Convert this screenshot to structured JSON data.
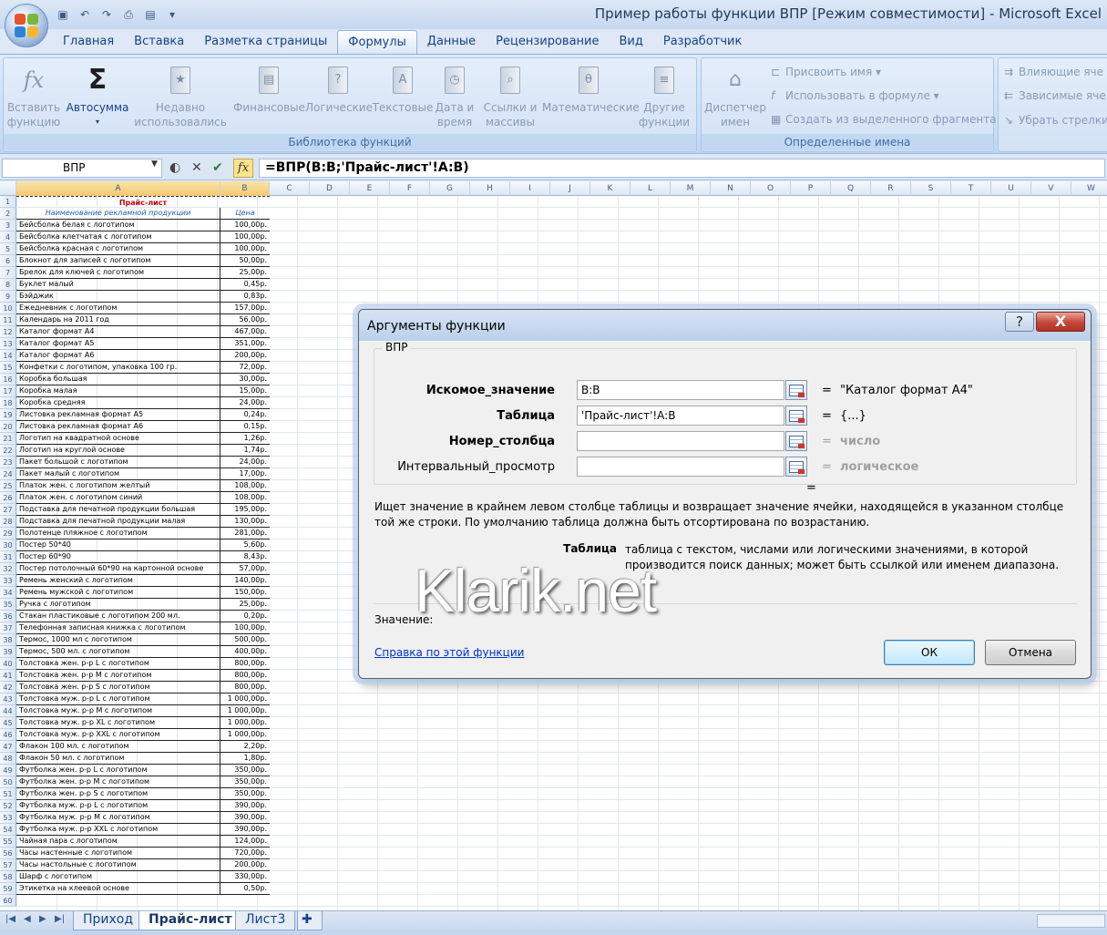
{
  "window": {
    "title": "Пример работы функции ВПР  [Режим совместимости] - Microsoft Excel"
  },
  "ribbon_tabs": [
    {
      "label": "Главная"
    },
    {
      "label": "Вставка"
    },
    {
      "label": "Разметка страницы"
    },
    {
      "label": "Формулы"
    },
    {
      "label": "Данные"
    },
    {
      "label": "Рецензирование"
    },
    {
      "label": "Вид"
    },
    {
      "label": "Разработчик"
    }
  ],
  "active_tab": "Формулы",
  "ribbon": {
    "insert_function": {
      "line1": "Вставить",
      "line2": "функцию"
    },
    "autosum": {
      "label": "Автосумма"
    },
    "recent": {
      "line1": "Недавно",
      "line2": "использовались"
    },
    "financial": {
      "label": "Финансовые"
    },
    "logical": {
      "label": "Логические"
    },
    "text": {
      "label": "Текстовые"
    },
    "datetime": {
      "line1": "Дата и",
      "line2": "время"
    },
    "lookup": {
      "line1": "Ссылки и",
      "line2": "массивы"
    },
    "math": {
      "label": "Математические"
    },
    "other": {
      "line1": "Другие",
      "line2": "функции"
    },
    "library_group": "Библиотека функций",
    "name_manager": {
      "line1": "Диспетчер",
      "line2": "имен"
    },
    "define_name": "Присвоить имя",
    "use_in_formula": "Использовать в формуле",
    "create_from_selection": "Создать из выделенного фрагмента",
    "defined_names_group": "Определенные имена",
    "trace_precedents": "Влияющие яче",
    "trace_dependents": "Зависимые яче",
    "remove_arrows": "Убрать стрелки"
  },
  "formula_bar": {
    "name_box": "ВПР",
    "fx": "fx",
    "formula": "=ВПР(B:B;'Прайс-лист'!A:B)"
  },
  "columns": [
    "A",
    "B",
    "C",
    "D",
    "E",
    "F",
    "G",
    "H",
    "I",
    "J",
    "K",
    "L",
    "M",
    "N",
    "O",
    "P",
    "Q",
    "R",
    "S",
    "T",
    "U",
    "V",
    "W"
  ],
  "sheet": {
    "title": "Прайс-лист",
    "header_a": "Наименование рекламной продукции",
    "header_b": "Цена",
    "rows": [
      [
        "Бейсболка белая с логотипом",
        "100,00р."
      ],
      [
        "Бейсболка клетчатая с логотипом",
        "100,00р."
      ],
      [
        "Бейсболка красная с логотипом",
        "100,00р."
      ],
      [
        "Блокнот для записей с логотипом",
        "50,00р."
      ],
      [
        "Брелок для ключей с логотипом",
        "25,00р."
      ],
      [
        "Буклет малый",
        "0,45р."
      ],
      [
        "Бэйджик",
        "0,83р."
      ],
      [
        "Ежедневник с логотипом",
        "157,00р."
      ],
      [
        "Календарь на 2011 год",
        "56,00р."
      ],
      [
        "Каталог формат А4",
        "467,00р."
      ],
      [
        "Каталог формат А5",
        "351,00р."
      ],
      [
        "Каталог формат А6",
        "200,00р."
      ],
      [
        "Конфетки с логотипом, упаковка 100 гр.",
        "72,00р."
      ],
      [
        "Коробка большая",
        "30,00р."
      ],
      [
        "Коробка малая",
        "15,00р."
      ],
      [
        "Коробка средняя",
        "24,00р."
      ],
      [
        "Листовка рекламная формат А5",
        "0,24р."
      ],
      [
        "Листовка рекламная формат А6",
        "0,15р."
      ],
      [
        "Логотип на квадратной основе",
        "1,26р."
      ],
      [
        "Логотип на круглой основе",
        "1,74р."
      ],
      [
        "Пакет большой с логотипом",
        "24,00р."
      ],
      [
        "Пакет малый с логотипом",
        "17,00р."
      ],
      [
        "Платок жен. с логотипом желтый",
        "108,00р."
      ],
      [
        "Платок жен. с логотипом синий",
        "108,00р."
      ],
      [
        "Подставка для печатной продукции большая",
        "195,00р."
      ],
      [
        "Подставка для печатной продукции малая",
        "130,00р."
      ],
      [
        "Полотенце пляжное с логотипом",
        "281,00р."
      ],
      [
        "Постер 50*40",
        "5,60р."
      ],
      [
        "Постер 60*90",
        "8,43р."
      ],
      [
        "Постер потолочный 60*90 на картонной основе",
        "57,00р."
      ],
      [
        "Ремень женский с логотипом",
        "140,00р."
      ],
      [
        "Ремень мужской с логотипом",
        "150,00р."
      ],
      [
        "Ручка с логотипом",
        "25,00р."
      ],
      [
        "Стакан пластиковые с логотипом 200 мл.",
        "0,20р."
      ],
      [
        "Телефонная записная книжка с логотипом",
        "100,00р."
      ],
      [
        "Термос, 1000 мл с логотипом",
        "500,00р."
      ],
      [
        "Термос, 500 мл. с логотипом",
        "400,00р."
      ],
      [
        "Толстовка жен. р-р L с логотипом",
        "800,00р."
      ],
      [
        "Толстовка жен. р-р M с логотипом",
        "800,00р."
      ],
      [
        "Толстовка жен. р-р S с логотипом",
        "800,00р."
      ],
      [
        "Толстовка муж. р-р L с логотипом",
        "1 000,00р."
      ],
      [
        "Толстовка муж. р-р M с логотипом",
        "1 000,00р."
      ],
      [
        "Толстовка муж. р-р XL с логотипом",
        "1 000,00р."
      ],
      [
        "Толстовка муж. р-р XXL с логотипом",
        "1 000,00р."
      ],
      [
        "Флакон 100 мл. с логотипом",
        "2,20р."
      ],
      [
        "Флакон 50 мл. с логотипом",
        "1,80р."
      ],
      [
        "Футболка жен. р-р L с логотипом",
        "350,00р."
      ],
      [
        "Футболка жен. р-р M с логотипом",
        "350,00р."
      ],
      [
        "Футболка жен. р-р S с логотипом",
        "350,00р."
      ],
      [
        "Футболка муж. р-р L с логотипом",
        "390,00р."
      ],
      [
        "Футболка муж. р-р M с логотипом",
        "390,00р."
      ],
      [
        "Футболка муж. р-р XXL с логотипом",
        "390,00р."
      ],
      [
        "Чайная пара с логотипом",
        "124,00р."
      ],
      [
        "Часы настенные с логотипом",
        "720,00р."
      ],
      [
        "Часы настольные с логотипом",
        "200,00р."
      ],
      [
        "Шарф с логотипом",
        "330,00р."
      ],
      [
        "Этикетка на клеевой основе",
        "0,50р."
      ]
    ],
    "row_count": 60
  },
  "sheet_tabs": [
    {
      "label": "Приход",
      "active": false
    },
    {
      "label": "Прайс-лист",
      "active": true
    },
    {
      "label": "Лист3",
      "active": false
    }
  ],
  "dialog": {
    "title": "Аргументы функции",
    "help_btn": "?",
    "close_btn": "X",
    "function_name": "ВПР",
    "args": [
      {
        "label": "Искомое_значение",
        "value": "B:B",
        "result": "\"Каталог формат А4\"",
        "bold": true,
        "result_gray": false
      },
      {
        "label": "Таблица",
        "value": "'Прайс-лист'!A:B",
        "result": "{...}",
        "bold": true,
        "result_gray": false
      },
      {
        "label": "Номер_столбца",
        "value": "",
        "result": "число",
        "bold": true,
        "result_gray": true
      },
      {
        "label": "Интервальный_просмотр",
        "value": "",
        "result": "логическое",
        "bold": false,
        "result_gray": true
      }
    ],
    "eq": "=",
    "description": "Ищет значение в крайнем левом столбце таблицы и возвращает значение ячейки, находящейся в указанном столбце той же строки. По умолчанию таблица должна быть отсортирована по возрастанию.",
    "arg_desc_name": "Таблица",
    "arg_desc_text": "таблица с текстом, числами или логическими значениями, в которой производится поиск данных; может быть ссылкой или именем диапазона.",
    "value_label": "Значение:",
    "help_link": "Справка по этой функции",
    "ok": "ОК",
    "cancel": "Отмена"
  },
  "watermark": "Klarik.net"
}
